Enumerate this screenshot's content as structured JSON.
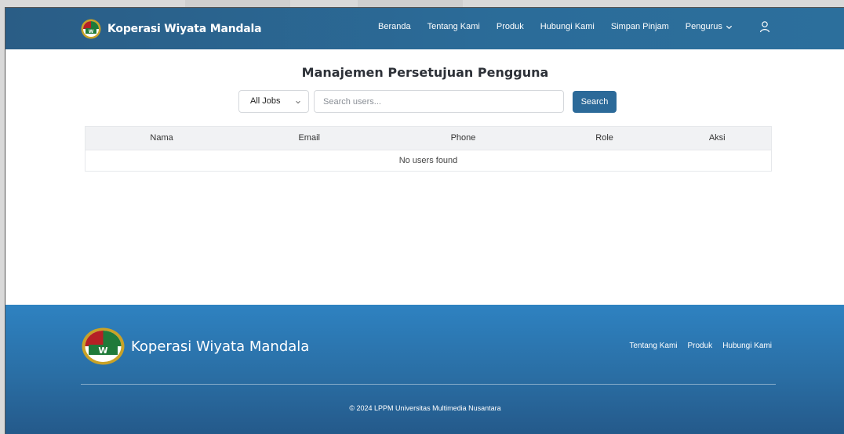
{
  "navbar": {
    "brand_name": "Koperasi Wiyata Mandala",
    "items": [
      {
        "label": "Beranda"
      },
      {
        "label": "Tentang Kami"
      },
      {
        "label": "Produk"
      },
      {
        "label": "Hubungi Kami"
      },
      {
        "label": "Simpan Pinjam"
      },
      {
        "label": "Pengurus"
      }
    ],
    "user_icon": "user-icon"
  },
  "main": {
    "title": "Manajemen Persetujuan Pengguna",
    "filter": {
      "selected": "All Jobs"
    },
    "search": {
      "placeholder": "Search users...",
      "value": "",
      "button_label": "Search"
    },
    "table": {
      "columns": [
        "Nama",
        "Email",
        "Phone",
        "Role",
        "Aksi"
      ],
      "empty_message": "No users found"
    }
  },
  "footer": {
    "brand_name": "Koperasi Wiyata Mandala",
    "links": [
      {
        "label": "Tentang Kami"
      },
      {
        "label": "Produk"
      },
      {
        "label": "Hubungi Kami"
      }
    ],
    "copyright": "© 2024 LPPM Universitas Multimedia Nusantara"
  },
  "colors": {
    "navbar": "#2b6c99",
    "button": "#2c6a99",
    "footer_top": "#2e82c1",
    "footer_bottom": "#24598a"
  }
}
